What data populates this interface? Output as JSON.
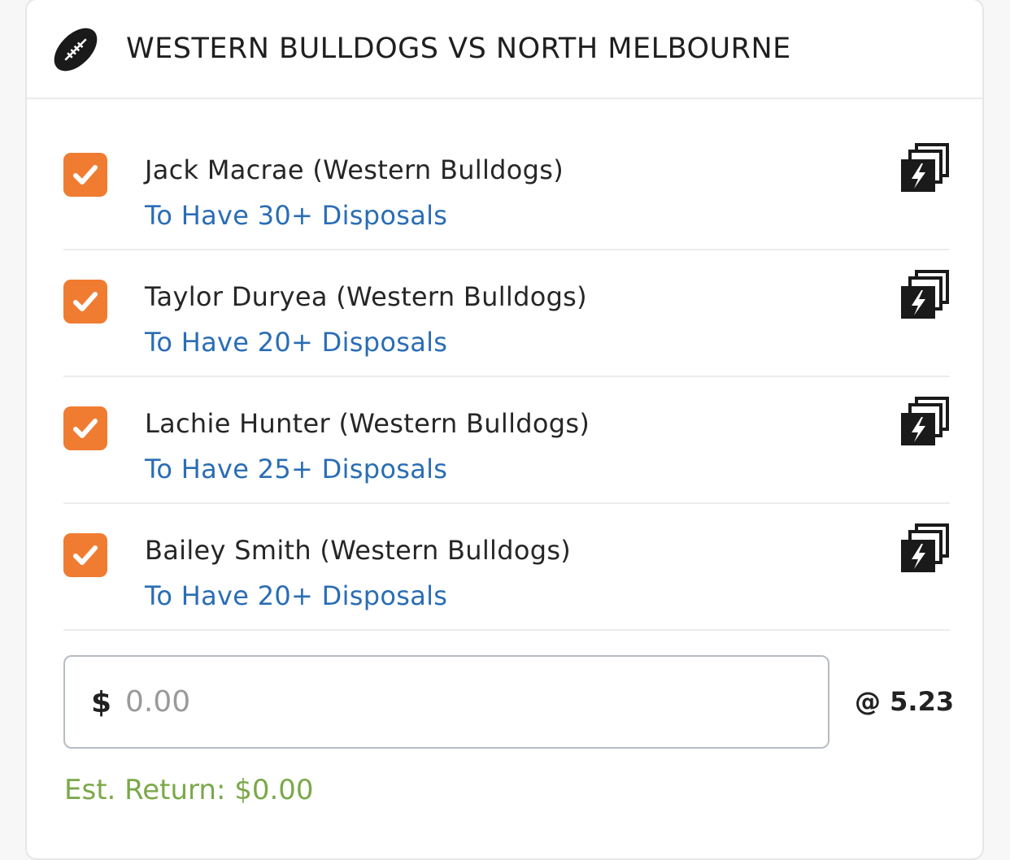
{
  "match": {
    "title": "WESTERN BULLDOGS VS NORTH MELBOURNE",
    "sport_icon": "football-icon"
  },
  "legs": [
    {
      "player": "Jack Macrae (Western Bulldogs)",
      "market": "To Have 30+ Disposals",
      "checked": true
    },
    {
      "player": "Taylor Duryea (Western Bulldogs)",
      "market": "To Have 20+ Disposals",
      "checked": true
    },
    {
      "player": "Lachie Hunter (Western Bulldogs)",
      "market": "To Have 25+ Disposals",
      "checked": true
    },
    {
      "player": "Bailey Smith (Western Bulldogs)",
      "market": "To Have 20+ Disposals",
      "checked": true
    }
  ],
  "stake": {
    "currency": "$",
    "placeholder": "0.00",
    "value": ""
  },
  "odds_label": "@ 5.23",
  "est_return": "Est. Return: $0.00",
  "colors": {
    "checkbox": "#f07c32",
    "market_link": "#2a6db5",
    "est_return": "#7ba84a"
  }
}
